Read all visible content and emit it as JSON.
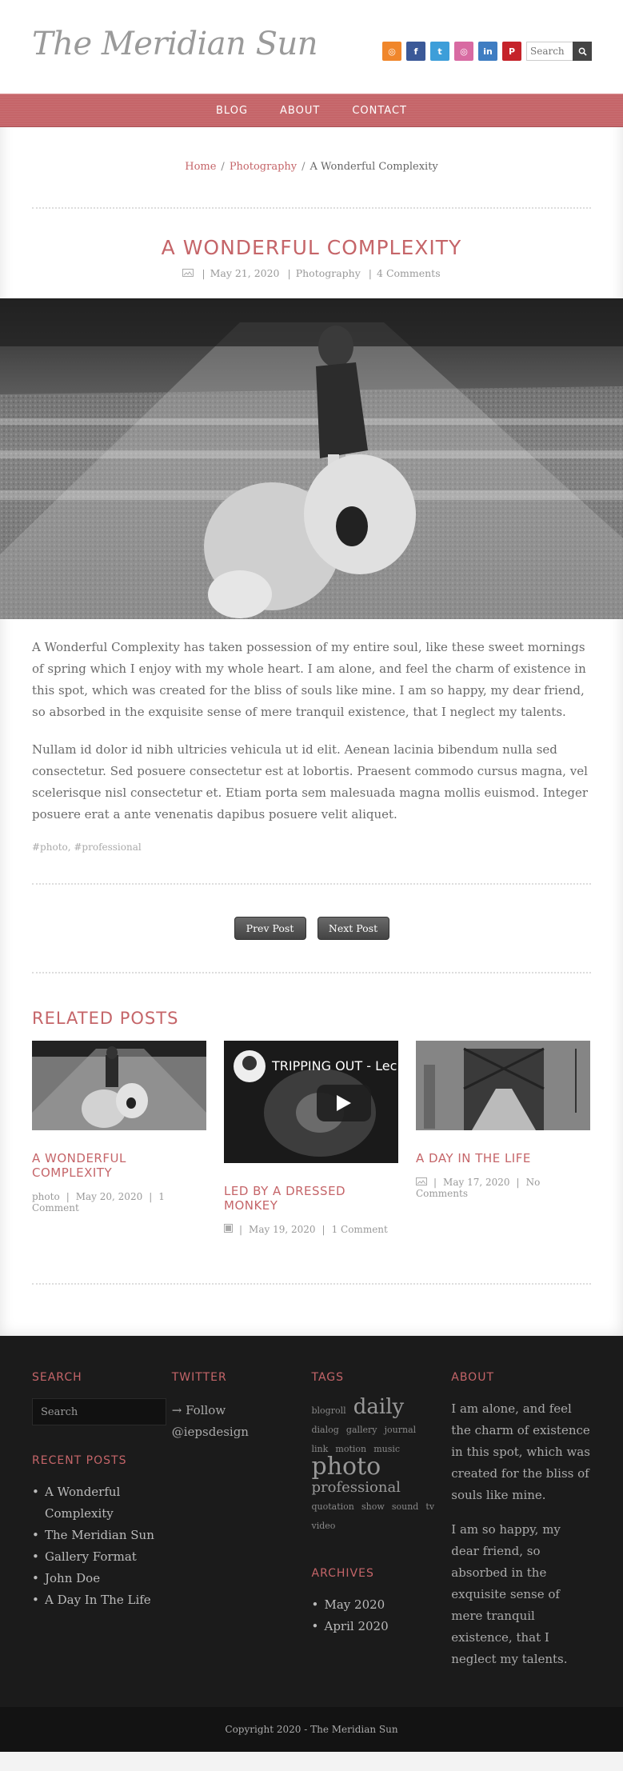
{
  "header": {
    "site_title": "The Meridian Sun",
    "search_placeholder": "Search"
  },
  "social_icons": [
    {
      "name": "rss-icon",
      "glyph": "◎",
      "color": "#f0862b"
    },
    {
      "name": "facebook-icon",
      "glyph": "f",
      "color": "#3b5998"
    },
    {
      "name": "twitter-icon",
      "glyph": "t",
      "color": "#3d9ed9"
    },
    {
      "name": "dribbble-icon",
      "glyph": "◎",
      "color": "#d86aa2"
    },
    {
      "name": "linkedin-icon",
      "glyph": "in",
      "color": "#3f7dc2"
    },
    {
      "name": "pinterest-icon",
      "glyph": "P",
      "color": "#c5232a"
    }
  ],
  "nav": {
    "items": [
      "BLOG",
      "ABOUT",
      "CONTACT"
    ]
  },
  "breadcrumb": {
    "home": "Home",
    "category": "Photography",
    "current": "A Wonderful Complexity",
    "sep": "/"
  },
  "post": {
    "title": "A WONDERFUL COMPLEXITY",
    "date": "May 21, 2020",
    "category": "Photography",
    "comments": "4 Comments",
    "paragraphs": [
      "A Wonderful Complexity has taken possession of my entire soul, like these sweet mornings of spring which I enjoy with my whole heart. I am alone, and feel the charm of existence in this spot, which was created for the bliss of souls like mine. I am so happy, my dear friend, so absorbed in the exquisite sense of mere tranquil existence, that I neglect my talents.",
      "Nullam id dolor id nibh ultricies vehicula ut id elit. Aenean lacinia bibendum nulla sed consectetur. Sed posuere consectetur est at lobortis. Praesent commodo cursus magna, vel scelerisque nisl consectetur et. Etiam porta sem malesuada magna mollis euismod. Integer posuere erat a ante venenatis dapibus posuere velit aliquet."
    ],
    "tags": "#photo, #professional"
  },
  "pager": {
    "prev": "Prev Post",
    "next": "Next Post"
  },
  "related": {
    "heading": "RELATED POSTS",
    "items": [
      {
        "title": "A WONDERFUL COMPLEXITY",
        "cat": "photo",
        "date": "May 20, 2020",
        "comments": "1 Comment"
      },
      {
        "title": "LED BY A DRESSED MONKEY",
        "video_title": "TRIPPING OUT - Lec",
        "date": "May 19, 2020",
        "comments": "1 Comment"
      },
      {
        "title": "A DAY IN THE LIFE",
        "date": "May 17, 2020",
        "comments": "No Comments"
      }
    ]
  },
  "footer": {
    "search_heading": "SEARCH",
    "search_placeholder": "Search",
    "recent_heading": "RECENT POSTS",
    "recent": [
      "A Wonderful Complexity",
      "The Meridian Sun",
      "Gallery Format",
      "John Doe",
      "A Day In The Life"
    ],
    "twitter_heading": "TWITTER",
    "twitter_follow": "→ Follow @iepsdesign",
    "tags_heading": "TAGS",
    "tags": [
      {
        "t": "blogroll",
        "s": 11
      },
      {
        "t": "daily",
        "s": 26
      },
      {
        "t": "dialog",
        "s": 11
      },
      {
        "t": "gallery",
        "s": 11
      },
      {
        "t": "journal",
        "s": 11
      },
      {
        "t": "link",
        "s": 11
      },
      {
        "t": "motion",
        "s": 11
      },
      {
        "t": "music",
        "s": 11
      },
      {
        "t": "photo",
        "s": 30
      },
      {
        "t": "professional",
        "s": 18
      },
      {
        "t": "quotation",
        "s": 11
      },
      {
        "t": "show",
        "s": 11
      },
      {
        "t": "sound",
        "s": 11
      },
      {
        "t": "tv",
        "s": 11
      },
      {
        "t": "video",
        "s": 11
      }
    ],
    "archives_heading": "ARCHIVES",
    "archives": [
      "May 2020",
      "April 2020"
    ],
    "about_heading": "ABOUT",
    "about": [
      "I am alone, and feel the charm of existence in this spot, which was created for the bliss of souls like mine.",
      "I am so happy, my dear friend, so absorbed in the exquisite sense of mere tranquil existence, that I neglect my talents."
    ]
  },
  "copyright": "Copyright 2020 - The Meridian Sun"
}
